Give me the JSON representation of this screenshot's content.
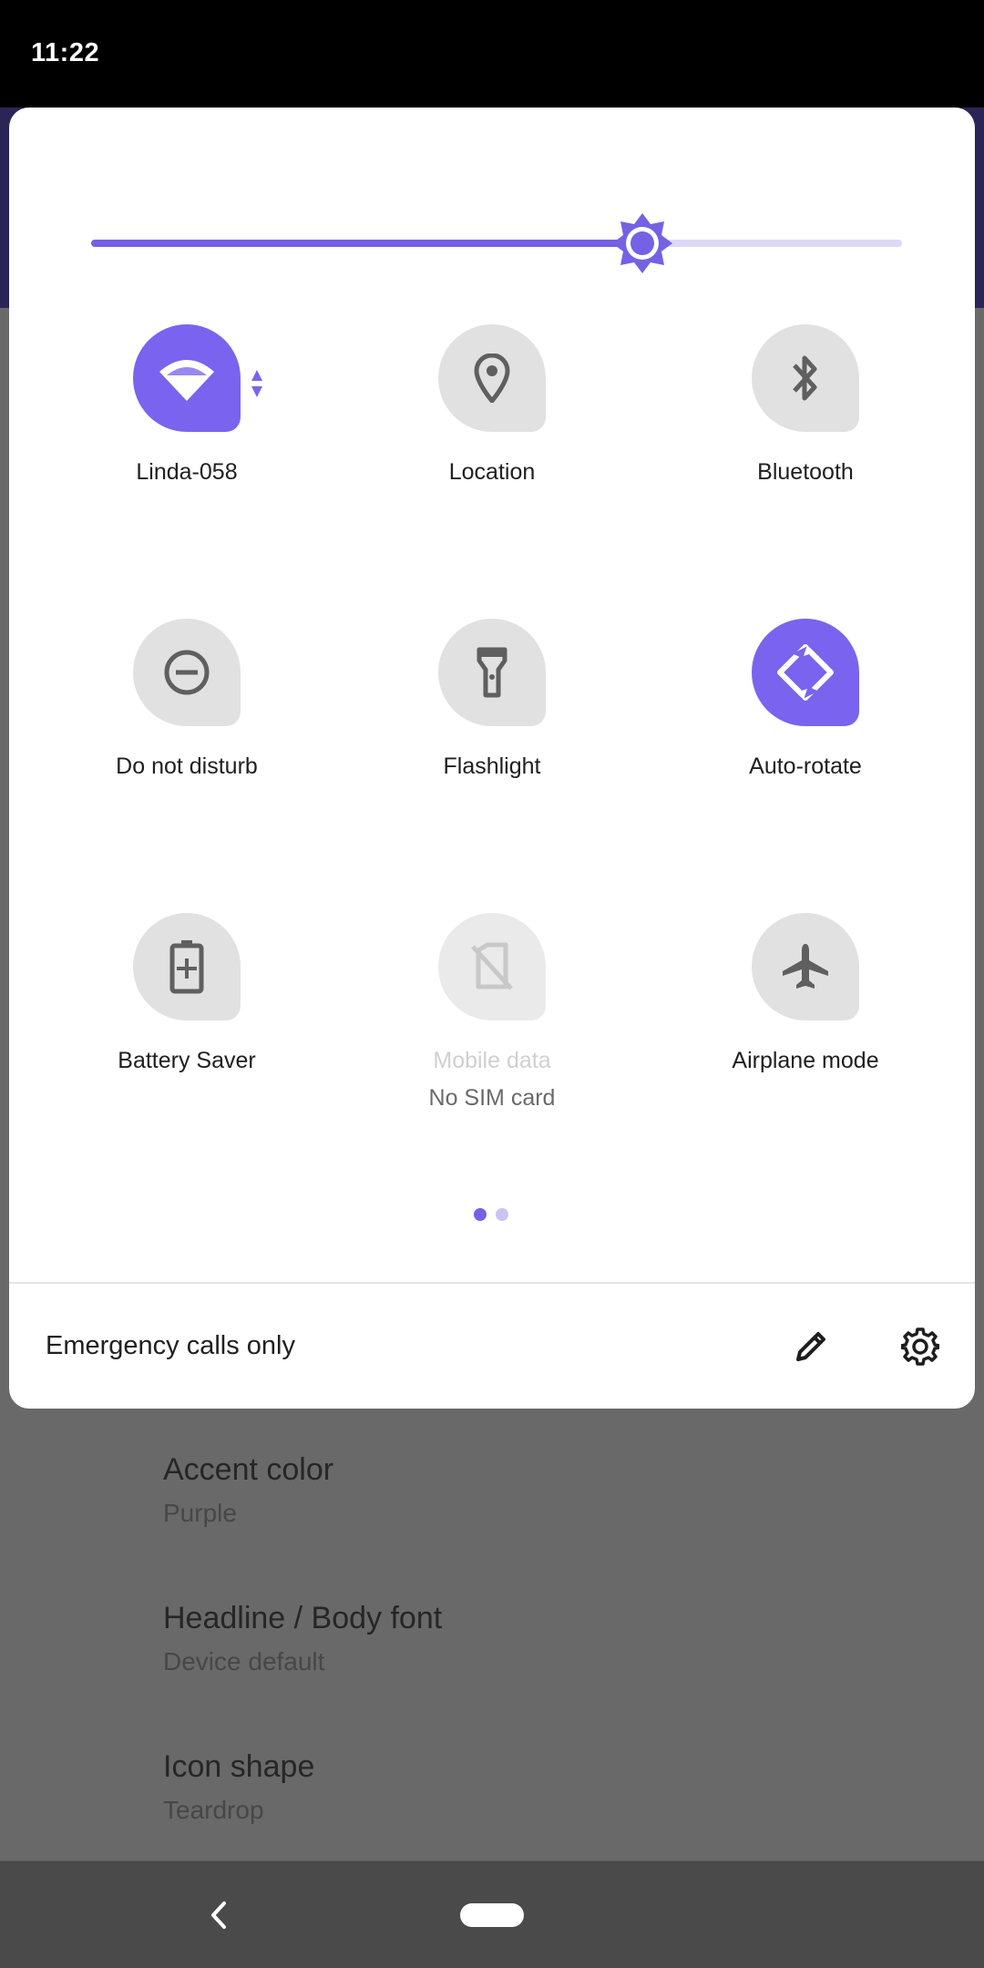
{
  "status_bar": {
    "time": "11:22"
  },
  "brightness": {
    "level_fraction": 0.68
  },
  "tiles": [
    {
      "label": "Linda-058",
      "icon": "wifi-icon",
      "state": "active"
    },
    {
      "label": "Location",
      "icon": "location-icon",
      "state": "inactive"
    },
    {
      "label": "Bluetooth",
      "icon": "bluetooth-icon",
      "state": "inactive"
    },
    {
      "label": "Do not disturb",
      "icon": "do-not-disturb-icon",
      "state": "inactive"
    },
    {
      "label": "Flashlight",
      "icon": "flashlight-icon",
      "state": "inactive"
    },
    {
      "label": "Auto-rotate",
      "icon": "auto-rotate-icon",
      "state": "active"
    },
    {
      "label": "Battery Saver",
      "icon": "battery-saver-icon",
      "state": "inactive"
    },
    {
      "label": "Mobile data",
      "sublabel": "No SIM card",
      "icon": "no-sim-icon",
      "state": "disabled"
    },
    {
      "label": "Airplane mode",
      "icon": "airplane-icon",
      "state": "inactive"
    }
  ],
  "page_indicator": {
    "pages": 2,
    "current": 1
  },
  "footer": {
    "carrier_text": "Emergency calls only"
  },
  "background_settings": [
    {
      "title": "Accent color",
      "value": "Purple"
    },
    {
      "title": "Headline / Body font",
      "value": "Device default"
    },
    {
      "title": "Icon shape",
      "value": "Teardrop"
    }
  ],
  "colors": {
    "accent": "#7a63ee",
    "accent_track_light": "#ddd8f5",
    "tile_inactive": "#e1e1e1",
    "icon_inactive": "#5f5f5f"
  }
}
